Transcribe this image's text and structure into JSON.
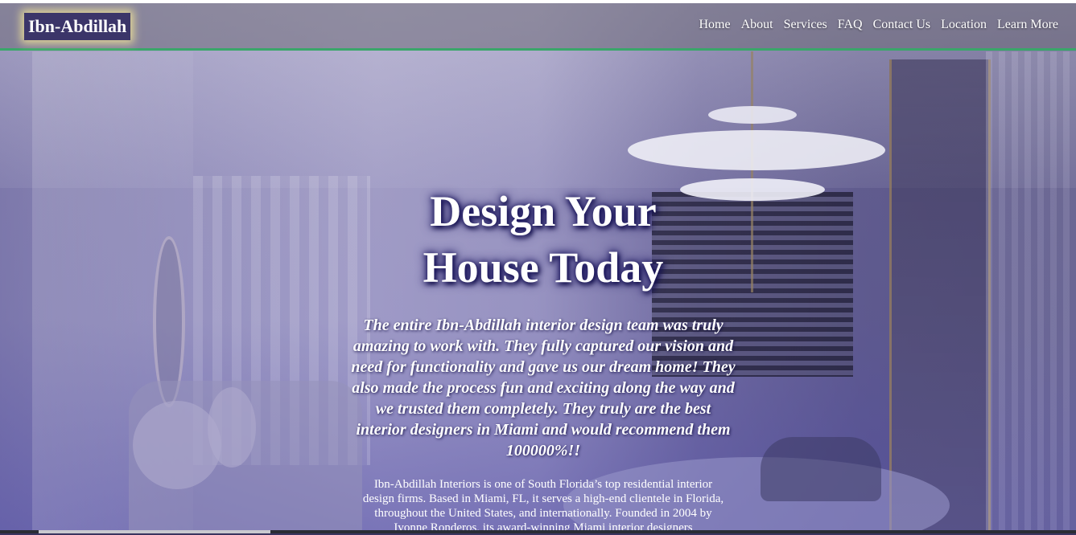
{
  "header": {
    "logo": "Ibn-Abdillah",
    "nav": [
      "Home",
      "About",
      "Services",
      "FAQ",
      "Contact Us",
      "Location",
      "Learn More"
    ]
  },
  "hero": {
    "title_line1": "Design Your",
    "title_line2": "House Today",
    "testimonial": "The entire Ibn-Abdillah interior design team was truly amazing to work with. They fully captured our vision and need for functionality and gave us our dream home! They also made the process fun and exciting along the way and we trusted them completely. They truly are the best interior designers in Miami and would recommend them 100000%!!",
    "about": "Ibn-Abdillah Interiors is one of South Florida’s top residential interior design firms. Based in Miami, FL, it serves a high-end clientele in Florida, throughout the United States, and internationally. Founded in 2004 by Ivonne Ronderos, its award-winning Miami interior designers"
  },
  "colors": {
    "accent_line": "#3aa66a",
    "logo_bg": "#3b3569",
    "logo_glow": "#fff096"
  }
}
